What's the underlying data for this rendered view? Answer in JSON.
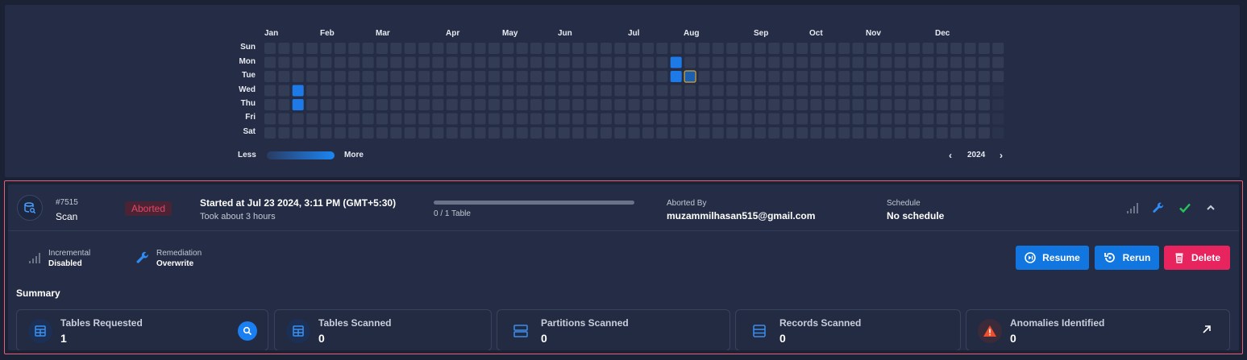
{
  "heatmap": {
    "months": [
      "Jan",
      "Feb",
      "Mar",
      "Apr",
      "May",
      "Jun",
      "Jul",
      "Aug",
      "Sep",
      "Oct",
      "Nov",
      "Dec"
    ],
    "days": [
      "Sun",
      "Mon",
      "Tue",
      "Wed",
      "Thu",
      "Fri",
      "Sat"
    ],
    "legend_less": "Less",
    "legend_more": "More",
    "year": "2024",
    "colors": {
      "empty": "#323c55",
      "active": "#1d7ae6",
      "selected_border": "#d9a22c"
    },
    "active_cells": [
      {
        "week": 2,
        "day": 3
      },
      {
        "week": 2,
        "day": 4
      },
      {
        "week": 29,
        "day": 1
      },
      {
        "week": 29,
        "day": 2
      }
    ],
    "selected_cell": {
      "week": 30,
      "day": 2
    }
  },
  "scan": {
    "id": "#7515",
    "type": "Scan",
    "status": "Aborted",
    "started": "Started at Jul 23 2024, 3:11 PM (GMT+5:30)",
    "duration": "Took about 3 hours",
    "progress_text": "0 / 1 Table",
    "progress": 0,
    "aborted_by_label": "Aborted By",
    "aborted_by": "muzammilhasan515@gmail.com",
    "schedule_label": "Schedule",
    "schedule": "No schedule",
    "incremental_label": "Incremental",
    "incremental_value": "Disabled",
    "remediation_label": "Remediation",
    "remediation_value": "Overwrite",
    "buttons": {
      "resume": "Resume",
      "rerun": "Rerun",
      "delete": "Delete"
    },
    "summary_title": "Summary",
    "stats": [
      {
        "label": "Tables Requested",
        "value": "1"
      },
      {
        "label": "Tables Scanned",
        "value": "0"
      },
      {
        "label": "Partitions Scanned",
        "value": "0"
      },
      {
        "label": "Records Scanned",
        "value": "0"
      },
      {
        "label": "Anomalies Identified",
        "value": "0"
      }
    ]
  }
}
